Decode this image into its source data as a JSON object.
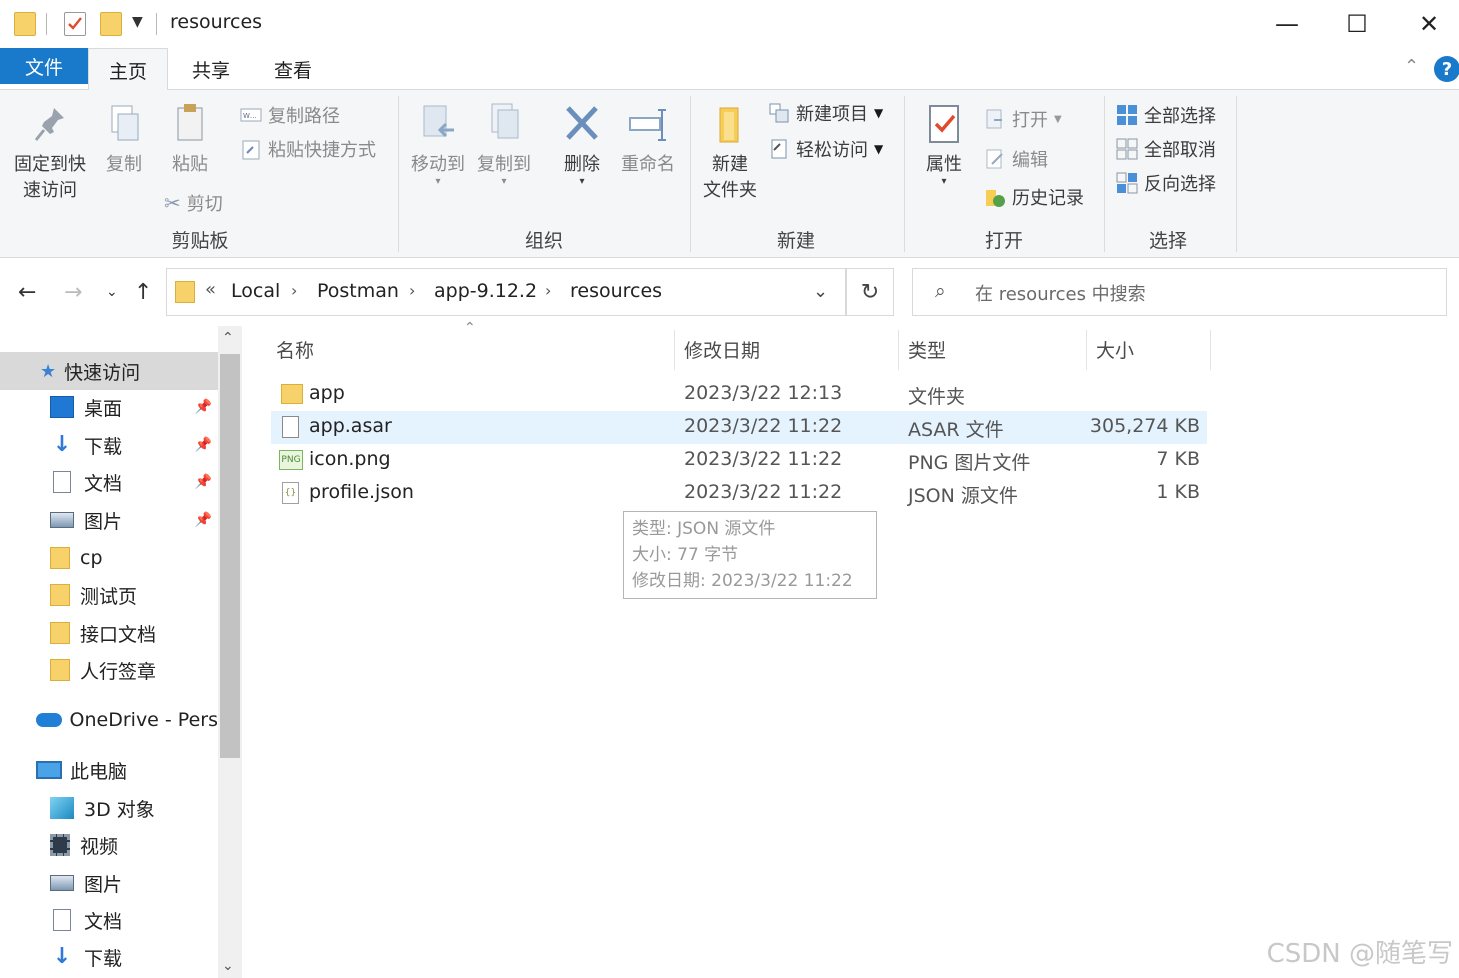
{
  "window": {
    "title": "resources",
    "minimize": "—",
    "maximize": "☐",
    "close": "✕"
  },
  "tabs": [
    {
      "label": "文件"
    },
    {
      "label": "主页"
    },
    {
      "label": "共享"
    },
    {
      "label": "查看"
    }
  ],
  "ribbon": {
    "pin_quick_access_l1": "固定到快",
    "pin_quick_access_l2": "速访问",
    "copy": "复制",
    "paste": "粘贴",
    "copy_path": "复制路径",
    "paste_shortcut": "粘贴快捷方式",
    "cut": "剪切",
    "group_clipboard": "剪贴板",
    "move_to": "移动到",
    "copy_to": "复制到",
    "delete": "删除",
    "rename": "重命名",
    "group_organize": "组织",
    "new_folder_l1": "新建",
    "new_folder_l2": "文件夹",
    "new_item": "新建项目",
    "easy_access": "轻松访问",
    "group_new": "新建",
    "properties": "属性",
    "open": "打开",
    "edit": "编辑",
    "history": "历史记录",
    "group_open": "打开",
    "select_all": "全部选择",
    "select_none": "全部取消",
    "invert_selection": "反向选择",
    "group_select": "选择"
  },
  "address": {
    "overflow": "«",
    "breadcrumbs": [
      "Local",
      "Postman",
      "app-9.12.2",
      "resources"
    ],
    "search_placeholder": "在 resources 中搜索"
  },
  "nav": {
    "quick_access": "快速访问",
    "items": [
      {
        "label": "桌面",
        "pinned": true
      },
      {
        "label": "下载",
        "pinned": true
      },
      {
        "label": "文档",
        "pinned": true
      },
      {
        "label": "图片",
        "pinned": true
      },
      {
        "label": "cp",
        "pinned": false
      },
      {
        "label": "测试页",
        "pinned": false
      },
      {
        "label": "接口文档",
        "pinned": false
      },
      {
        "label": "人行签章",
        "pinned": false
      }
    ],
    "onedrive": "OneDrive - Pers",
    "this_pc": "此电脑",
    "pc_items": [
      {
        "label": "3D 对象"
      },
      {
        "label": "视频"
      },
      {
        "label": "图片"
      },
      {
        "label": "文档"
      },
      {
        "label": "下载"
      }
    ]
  },
  "columns": {
    "name": "名称",
    "modified": "修改日期",
    "type": "类型",
    "size": "大小"
  },
  "files": [
    {
      "name": "app",
      "modified": "2023/3/22 12:13",
      "type": "文件夹",
      "size": "",
      "icon": "folder-icon"
    },
    {
      "name": "app.asar",
      "modified": "2023/3/22 11:22",
      "type": "ASAR 文件",
      "size": "305,274 KB",
      "icon": "file-icon"
    },
    {
      "name": "icon.png",
      "modified": "2023/3/22 11:22",
      "type": "PNG 图片文件",
      "size": "7 KB",
      "icon": "png-icon"
    },
    {
      "name": "profile.json",
      "modified": "2023/3/22 11:22",
      "type": "JSON 源文件",
      "size": "1 KB",
      "icon": "json-icon"
    }
  ],
  "tooltip": {
    "type": "类型: JSON 源文件",
    "size": "大小: 77 字节",
    "modified": "修改日期: 2023/3/22 11:22"
  },
  "watermark": "CSDN @随笔写"
}
